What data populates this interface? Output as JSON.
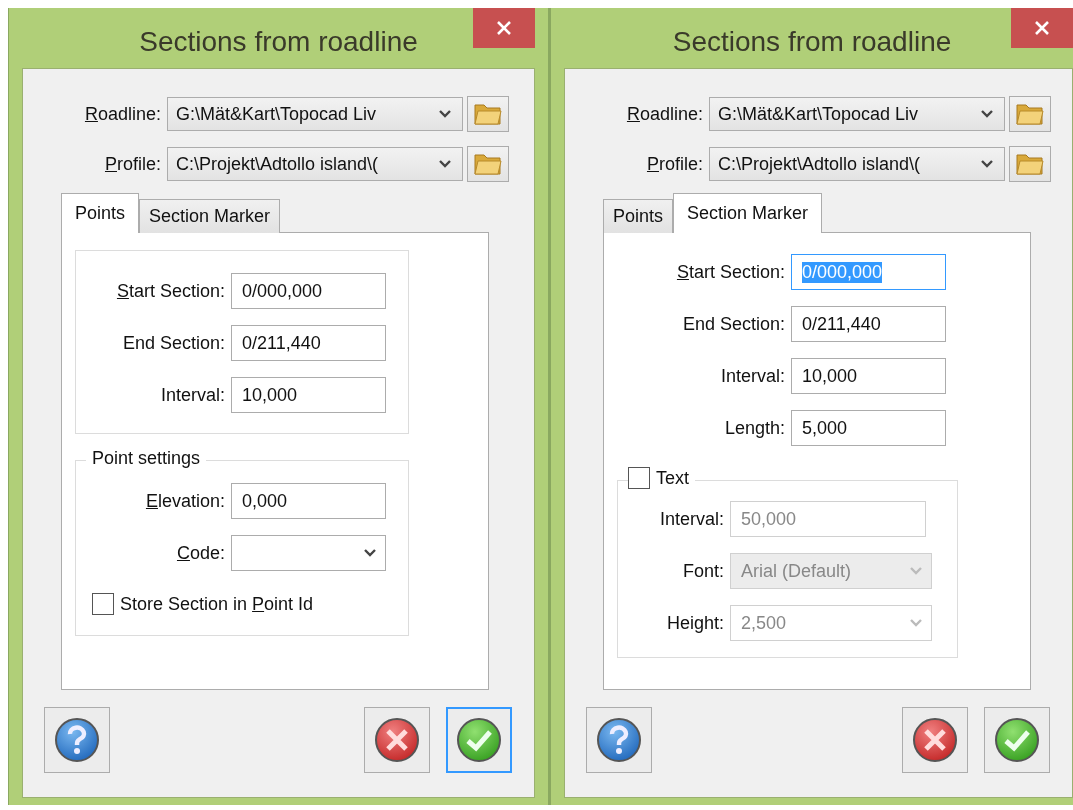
{
  "dialogs": [
    {
      "title": "Sections from roadline",
      "paths": [
        {
          "label": {
            "key": "R",
            "post": "oadline:"
          },
          "value": "G:\\Mät&Kart\\Topocad Liv"
        },
        {
          "label": {
            "key": "P",
            "post": "rofile:"
          },
          "value": "C:\\Projekt\\Adtollo island\\("
        }
      ],
      "tabs": [
        {
          "label": "Points",
          "selected": true
        },
        {
          "label": "Section Marker",
          "selected": false
        }
      ],
      "sections": [
        {
          "kind": "group",
          "rows": [
            {
              "kind": "input",
              "label": {
                "key": "S",
                "post": "tart Section:"
              },
              "value": "0/000,000",
              "text_selected": false,
              "disabled": false
            },
            {
              "kind": "input",
              "label": "End Section:",
              "value": "0/211,440",
              "text_selected": false,
              "disabled": false
            },
            {
              "kind": "input",
              "label": "Interval:",
              "value": "10,000",
              "text_selected": false,
              "disabled": false
            }
          ]
        },
        {
          "kind": "group",
          "title": "Point settings",
          "rows": [
            {
              "kind": "input",
              "label": {
                "key": "E",
                "post": "levation:"
              },
              "value": "0,000",
              "text_selected": false,
              "disabled": false
            },
            {
              "kind": "select",
              "label": {
                "key": "C",
                "post": "ode:"
              },
              "disabled": false
            },
            {
              "kind": "checkbox",
              "label": {
                "pre": "Store Section in ",
                "key": "P",
                "post": "oint Id"
              },
              "checked": false
            }
          ]
        }
      ],
      "buttons": [
        {
          "kind": "help",
          "focused": false
        },
        {
          "kind": "cancel",
          "focused": false
        },
        {
          "kind": "ok",
          "focused": true
        }
      ]
    },
    {
      "title": "Sections from roadline",
      "paths": [
        {
          "label": {
            "key": "R",
            "post": "oadline:"
          },
          "value": "G:\\Mät&Kart\\Topocad Liv"
        },
        {
          "label": {
            "key": "P",
            "post": "rofile:"
          },
          "value": "C:\\Projekt\\Adtollo island\\("
        }
      ],
      "tabs": [
        {
          "label": "Points",
          "selected": false
        },
        {
          "label": "Section Marker",
          "selected": true
        }
      ],
      "sections": [
        {
          "kind": "bare",
          "rows": [
            {
              "kind": "input",
              "label": {
                "key": "S",
                "post": "tart Section:"
              },
              "value": "0/000,000",
              "text_selected": true,
              "disabled": false
            },
            {
              "kind": "input",
              "label": "End Section:",
              "value": "0/211,440",
              "text_selected": false,
              "disabled": false
            },
            {
              "kind": "input",
              "label": "Interval:",
              "value": "10,000",
              "text_selected": false,
              "disabled": false
            },
            {
              "kind": "input",
              "label": "Length:",
              "value": "5,000",
              "text_selected": false,
              "disabled": false
            }
          ]
        },
        {
          "kind": "check-group",
          "title": "Text",
          "checked": false,
          "rows": [
            {
              "kind": "input",
              "label": "Interval:",
              "value": "50,000",
              "text_selected": false,
              "disabled": true
            },
            {
              "kind": "select",
              "label": "Font:",
              "value": "Arial (Default)",
              "disabled": true,
              "shaded": true
            },
            {
              "kind": "select",
              "label": "Height:",
              "value": "2,500",
              "disabled": true,
              "shaded": false
            }
          ]
        }
      ],
      "buttons": [
        {
          "kind": "help",
          "focused": false
        },
        {
          "kind": "cancel",
          "focused": false
        },
        {
          "kind": "ok",
          "focused": false
        }
      ]
    }
  ]
}
